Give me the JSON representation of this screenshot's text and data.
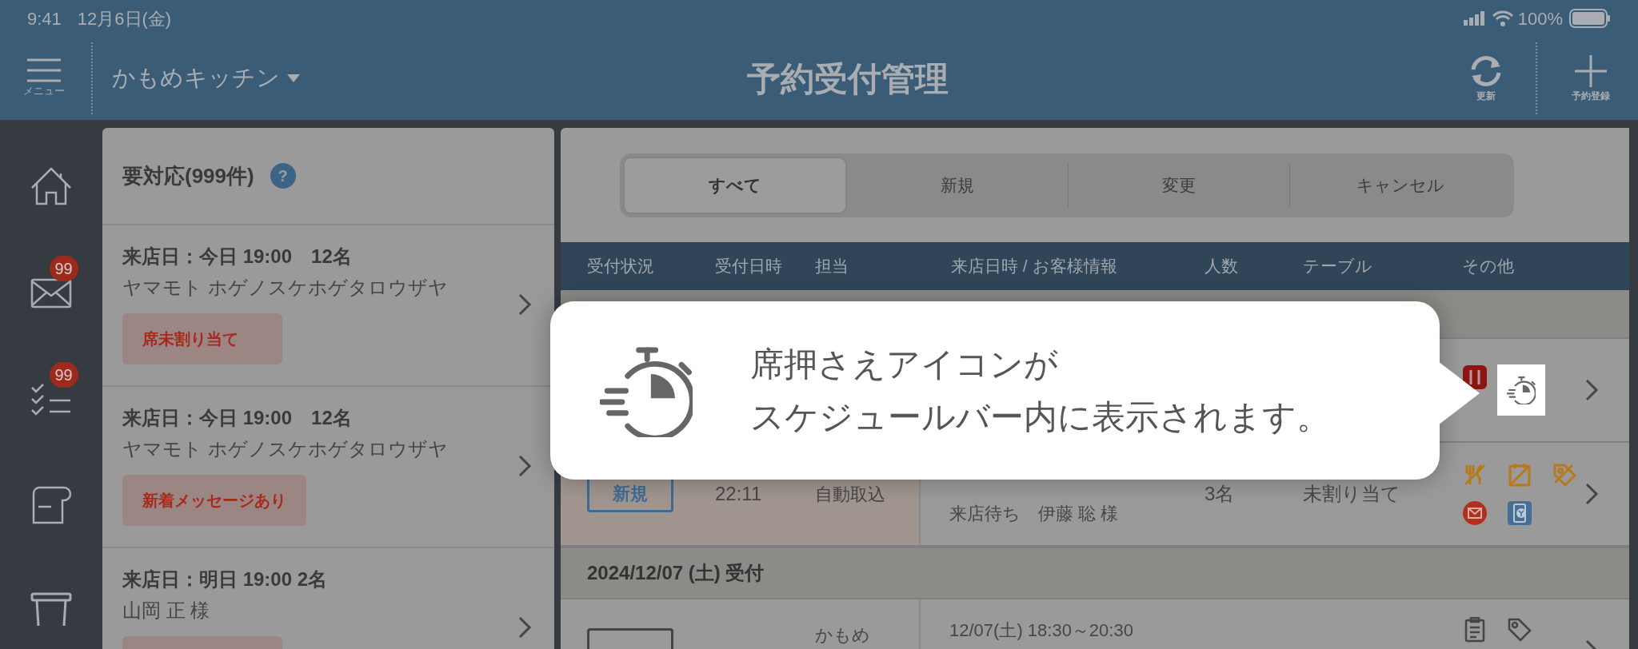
{
  "status_bar": {
    "time": "9:41",
    "date": "12月6日(金)",
    "battery": "100%"
  },
  "header": {
    "menu_label": "メニュー",
    "store": "かもめキッチン",
    "title": "予約受付管理",
    "refresh_label": "更新",
    "add_label": "予約登録"
  },
  "sidebar": {
    "items": [
      {
        "kind": "home"
      },
      {
        "kind": "mail",
        "badge": "99"
      },
      {
        "kind": "tasks",
        "badge": "99"
      },
      {
        "kind": "receipt"
      },
      {
        "kind": "table"
      }
    ]
  },
  "attention": {
    "title": "要対応(999件)",
    "help": "?",
    "items": [
      {
        "visit": "来店日：今日 19:00　12名",
        "name": "ヤマモト ホゲノスケホゲタロウザヤ",
        "badge": "席未割り当て"
      },
      {
        "visit": "来店日：今日 19:00　12名",
        "name": "ヤマモト ホゲノスケホゲタロウザヤ",
        "badge": "新着メッセージあり"
      },
      {
        "visit": "来店日：明日 19:00 2名",
        "name": "山岡 正 様"
      }
    ]
  },
  "tabs": [
    {
      "label": "すべて",
      "selected": true
    },
    {
      "label": "新規",
      "selected": false
    },
    {
      "label": "変更",
      "selected": false
    },
    {
      "label": "キャンセル",
      "selected": false
    }
  ],
  "table": {
    "columns": [
      "受付状況",
      "受付日時",
      "担当",
      "来店日時 / お客様情報",
      "人数",
      "テーブル",
      "その他"
    ],
    "sections": [
      {
        "rows": [
          {
            "kind": "covered",
            "icons": [
              {
                "kind": "seat-red"
              },
              {
                "kind": "timer"
              }
            ]
          },
          {
            "kind": "new",
            "status": "新規",
            "time": "22:11",
            "staff": "自動取込",
            "visit_info": "来店待ち　伊藤 聡 様",
            "people": "3名",
            "table": "未割り当て",
            "icons": [
              {
                "kind": "no-food"
              },
              {
                "kind": "no-note"
              },
              {
                "kind": "no-tag"
              },
              {
                "kind": "mail"
              },
              {
                "kind": "phone-yen"
              }
            ]
          }
        ]
      },
      {
        "title": "2024/12/07 (土) 受付",
        "rows": [
          {
            "kind": "cancel",
            "staff": "かもめ",
            "visit": "12/07(土) 18:30～20:30",
            "icons": [
              {
                "kind": "clipboard"
              },
              {
                "kind": "tag"
              }
            ]
          }
        ]
      }
    ]
  },
  "tooltip": {
    "lines": [
      "席押さえアイコンが",
      "スケジュールバー内に表示されます。"
    ]
  }
}
